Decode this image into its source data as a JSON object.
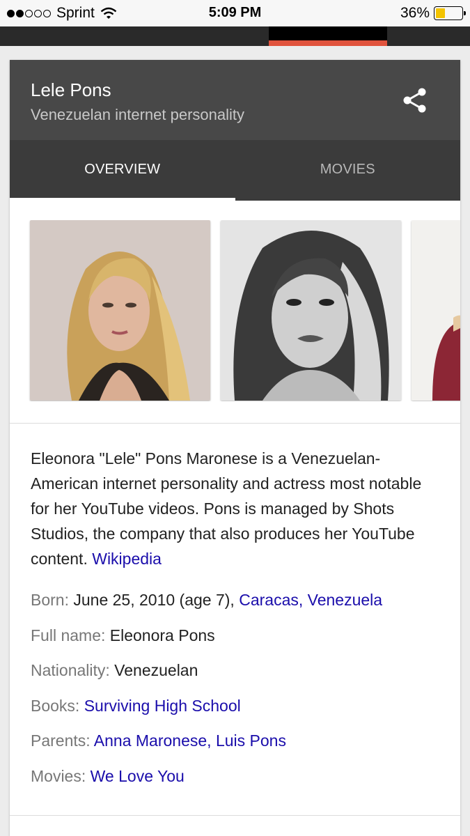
{
  "status_bar": {
    "signal_dots_filled": 2,
    "signal_dots_total": 5,
    "carrier": "Sprint",
    "time": "5:09 PM",
    "battery_percent": "36%",
    "battery_level": 0.36,
    "battery_color": "#f4c400"
  },
  "top_strip": {
    "accent_color": "#e0533d"
  },
  "card": {
    "title": "Lele Pons",
    "subtitle": "Venezuelan internet personality",
    "share_icon": "share-icon",
    "tabs": [
      {
        "label": "OVERVIEW",
        "active": true
      },
      {
        "label": "MOVIES",
        "active": false
      }
    ],
    "images": [
      "blonde-portrait",
      "black-and-white-portrait",
      "partial-portrait"
    ],
    "description": "Eleonora \"Lele\" Pons Maronese is a Venezuelan-American internet personality and actress most notable for her YouTube videos. Pons is managed by Shots Studios, the company that also produces her YouTube content. ",
    "description_link": "Wikipedia",
    "facts": {
      "born": {
        "label": "Born:",
        "value": " June 25, 2010 (age 7), ",
        "link": "Caracas, Venezuela"
      },
      "full_name": {
        "label": "Full name:",
        "value": " Eleonora Pons"
      },
      "nationality": {
        "label": "Nationality:",
        "value": " Venezuelan"
      },
      "books": {
        "label": "Books:",
        "link": "Surviving High School"
      },
      "parents": {
        "label": "Parents:",
        "link1": "Anna Maronese",
        "sep": ", ",
        "link2": "Luis Pons"
      },
      "movies": {
        "label": "Movies:",
        "link": "We Love You"
      }
    },
    "link_color": "#1a0dab"
  }
}
